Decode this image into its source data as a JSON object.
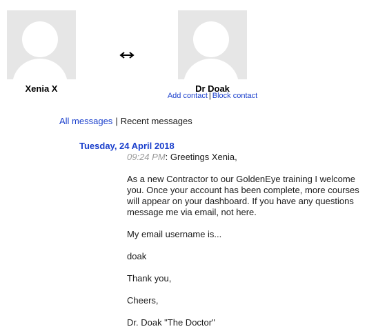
{
  "users": {
    "left": {
      "name": "Xenia X"
    },
    "right": {
      "name": "Dr Doak",
      "add_contact": "Add contact",
      "separator": "|",
      "block_contact": "Block contact"
    },
    "swap_icon": "double-arrow-icon"
  },
  "tabs": {
    "all": "All messages",
    "separator": "|",
    "recent": "Recent messages"
  },
  "conversation": {
    "date": "Tuesday, 24 April 2018",
    "message": {
      "time": "09:24 PM",
      "time_suffix": ":",
      "first_line": " Greetings Xenia,",
      "paragraphs": [
        "As a new Contractor to our GoldenEye training I welcome you. Once your account has been complete, more courses will appear on your dashboard. If you have any questions message me via email, not here.",
        "My email username is...",
        "doak",
        "Thank you,",
        "Cheers,",
        "Dr. Doak \"The Doctor\""
      ]
    }
  }
}
